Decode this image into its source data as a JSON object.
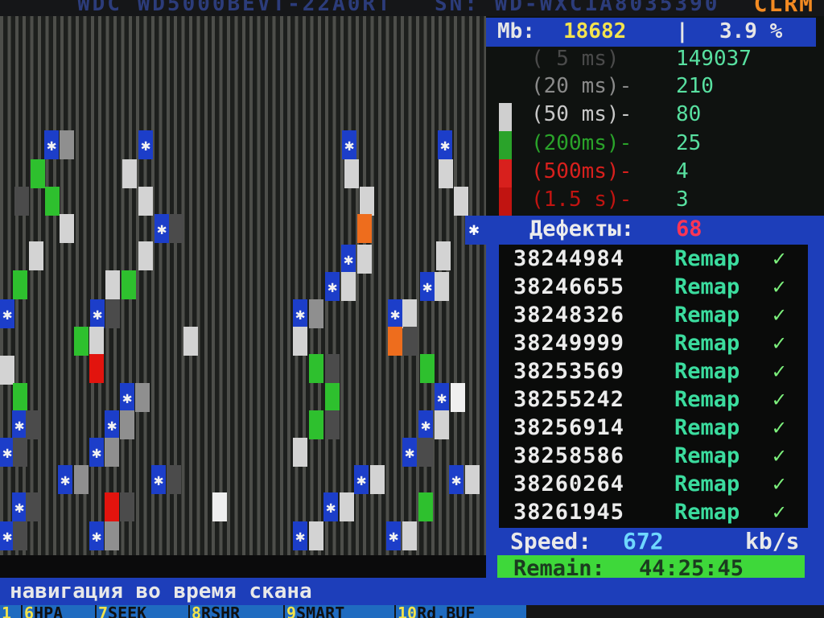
{
  "topbar": {
    "model": "WDC WD5000BEVT-22A0RT",
    "serial": "SN: WD-WXC1A8035390",
    "mode": "CLRM"
  },
  "stats": {
    "mb_label": "Mb:",
    "mb_value": "18682",
    "separator": "|",
    "percent": "3.9 %",
    "latency": [
      {
        "label": "( 5 ms)",
        "count": "149037",
        "color": "#444444"
      },
      {
        "label": "(20 ms)-",
        "count": "210",
        "color": "#6a6a6a"
      },
      {
        "label": "(50 ms)-",
        "count": "80",
        "color": "#c7c7c7"
      },
      {
        "label": "(200ms)-",
        "count": "25",
        "color": "#2aa32a"
      },
      {
        "label": "(500ms)-",
        "count": "4",
        "color": "#d8201d"
      },
      {
        "label": "(1.5 s)-",
        "count": "3",
        "color": "#c11411"
      }
    ]
  },
  "defects": {
    "label": "Дефекты:",
    "count": "68",
    "rows": [
      {
        "sector": "38244984",
        "status": "Remap",
        "mark": "✓"
      },
      {
        "sector": "38246655",
        "status": "Remap",
        "mark": "✓"
      },
      {
        "sector": "38248326",
        "status": "Remap",
        "mark": "✓"
      },
      {
        "sector": "38249999",
        "status": "Remap",
        "mark": "✓"
      },
      {
        "sector": "38253569",
        "status": "Remap",
        "mark": "✓"
      },
      {
        "sector": "38255242",
        "status": "Remap",
        "mark": "✓"
      },
      {
        "sector": "38256914",
        "status": "Remap",
        "mark": "✓"
      },
      {
        "sector": "38258586",
        "status": "Remap",
        "mark": "✓"
      },
      {
        "sector": "38260264",
        "status": "Remap",
        "mark": "✓"
      },
      {
        "sector": "38261945",
        "status": "Remap",
        "mark": "✓"
      }
    ]
  },
  "speed": {
    "label": "Speed:",
    "value": "672",
    "unit": "kb/s"
  },
  "remain": {
    "label": "Remain:",
    "value": "44:25:45"
  },
  "hint": "навигация во время скана",
  "fkeys": [
    {
      "num": "1",
      "text": ""
    },
    {
      "num": "6",
      "text": "HPA"
    },
    {
      "num": "7",
      "text": "SEEK"
    },
    {
      "num": "8",
      "text": "RSHR"
    },
    {
      "num": "9",
      "text": "SMART"
    },
    {
      "num": "10",
      "text": "Rd.BUF"
    }
  ],
  "legend_colors": [
    "#cfcfcf",
    "#2aa32a",
    "#d8201d",
    "#c11411"
  ],
  "scan_map": {
    "star_glyph": "✱",
    "blocks": [
      [
        55,
        162,
        "star"
      ],
      [
        74,
        162,
        "gray"
      ],
      [
        172,
        162,
        "star"
      ],
      [
        425,
        162,
        "star"
      ],
      [
        544,
        162,
        "star"
      ],
      [
        38,
        198,
        "green"
      ],
      [
        152,
        198,
        "light"
      ],
      [
        428,
        198,
        "light"
      ],
      [
        545,
        198,
        "light"
      ],
      [
        18,
        232,
        "dark"
      ],
      [
        56,
        232,
        "green"
      ],
      [
        172,
        232,
        "light"
      ],
      [
        447,
        232,
        "light"
      ],
      [
        564,
        232,
        "light"
      ],
      [
        74,
        266,
        "light"
      ],
      [
        192,
        266,
        "star"
      ],
      [
        210,
        266,
        "dark"
      ],
      [
        444,
        266,
        "orange"
      ],
      [
        36,
        300,
        "light"
      ],
      [
        172,
        300,
        "light"
      ],
      [
        424,
        304,
        "star"
      ],
      [
        444,
        304,
        "light"
      ],
      [
        542,
        300,
        "light"
      ],
      [
        16,
        336,
        "green"
      ],
      [
        131,
        336,
        "light"
      ],
      [
        151,
        336,
        "green"
      ],
      [
        404,
        338,
        "star"
      ],
      [
        424,
        338,
        "light"
      ],
      [
        522,
        338,
        "star"
      ],
      [
        540,
        338,
        "light"
      ],
      [
        0,
        372,
        "star"
      ],
      [
        112,
        372,
        "star"
      ],
      [
        131,
        372,
        "dark"
      ],
      [
        364,
        372,
        "star"
      ],
      [
        384,
        372,
        "gray"
      ],
      [
        482,
        372,
        "star"
      ],
      [
        500,
        372,
        "light"
      ],
      [
        92,
        406,
        "green"
      ],
      [
        111,
        406,
        "light"
      ],
      [
        228,
        406,
        "light"
      ],
      [
        364,
        406,
        "light"
      ],
      [
        482,
        406,
        "orange"
      ],
      [
        501,
        406,
        "dark"
      ],
      [
        111,
        440,
        "red"
      ],
      [
        384,
        440,
        "green"
      ],
      [
        404,
        440,
        "dark"
      ],
      [
        522,
        440,
        "green"
      ],
      [
        0,
        442,
        "light"
      ],
      [
        149,
        476,
        "star"
      ],
      [
        168,
        476,
        "gray"
      ],
      [
        404,
        476,
        "green"
      ],
      [
        540,
        476,
        "star"
      ],
      [
        560,
        476,
        "white"
      ],
      [
        16,
        476,
        "green"
      ],
      [
        15,
        510,
        "star"
      ],
      [
        32,
        510,
        "dark"
      ],
      [
        130,
        510,
        "star"
      ],
      [
        149,
        510,
        "gray"
      ],
      [
        384,
        510,
        "green"
      ],
      [
        404,
        510,
        "dark"
      ],
      [
        520,
        510,
        "star"
      ],
      [
        540,
        510,
        "light"
      ],
      [
        0,
        544,
        "star"
      ],
      [
        16,
        544,
        "dark"
      ],
      [
        111,
        544,
        "star"
      ],
      [
        130,
        544,
        "gray"
      ],
      [
        364,
        544,
        "light"
      ],
      [
        500,
        544,
        "star"
      ],
      [
        520,
        544,
        "dark"
      ],
      [
        72,
        578,
        "star"
      ],
      [
        92,
        578,
        "gray"
      ],
      [
        188,
        578,
        "star"
      ],
      [
        207,
        578,
        "dark"
      ],
      [
        440,
        578,
        "star"
      ],
      [
        460,
        578,
        "light"
      ],
      [
        558,
        578,
        "star"
      ],
      [
        578,
        578,
        "light"
      ],
      [
        15,
        612,
        "star"
      ],
      [
        32,
        612,
        "dark"
      ],
      [
        130,
        612,
        "red"
      ],
      [
        149,
        612,
        "dark"
      ],
      [
        264,
        612,
        "white"
      ],
      [
        402,
        612,
        "star"
      ],
      [
        422,
        612,
        "light"
      ],
      [
        520,
        612,
        "green"
      ],
      [
        0,
        648,
        "star"
      ],
      [
        16,
        648,
        "dark"
      ],
      [
        111,
        648,
        "star"
      ],
      [
        130,
        648,
        "gray"
      ],
      [
        364,
        648,
        "star"
      ],
      [
        384,
        648,
        "light"
      ],
      [
        480,
        648,
        "star"
      ],
      [
        500,
        648,
        "light"
      ]
    ]
  }
}
